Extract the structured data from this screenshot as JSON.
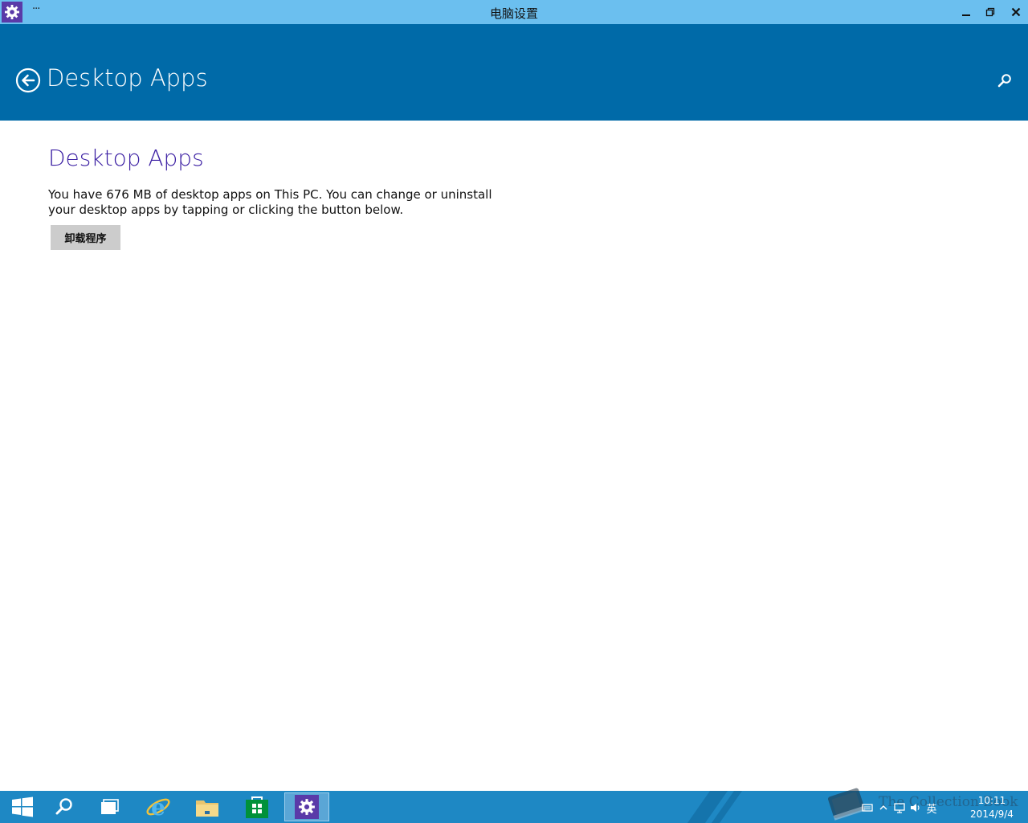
{
  "window": {
    "title": "电脑设置",
    "menu_label": "···"
  },
  "header": {
    "title": "Desktop Apps"
  },
  "content": {
    "heading": "Desktop Apps",
    "description": "You have 676 MB of desktop apps on This PC. You can change or uninstall your desktop apps by tapping or clicking the button below.",
    "uninstall_button": "卸载程序"
  },
  "taskbar": {
    "items": [
      "start",
      "search",
      "task-view",
      "internet-explorer",
      "file-explorer",
      "store",
      "pc-settings"
    ],
    "active_item": "pc-settings",
    "tray": {
      "input_language": "英",
      "time": "10:11",
      "date": "2014/9/4"
    }
  },
  "watermark": {
    "text": "The Collection Book"
  },
  "colors": {
    "titlebar": "#6bbfef",
    "header": "#006aa8",
    "heading": "#3b1fa3",
    "button": "#cccccc",
    "taskbar": "#1e88c4",
    "app_icon": "#5a3aa8"
  }
}
